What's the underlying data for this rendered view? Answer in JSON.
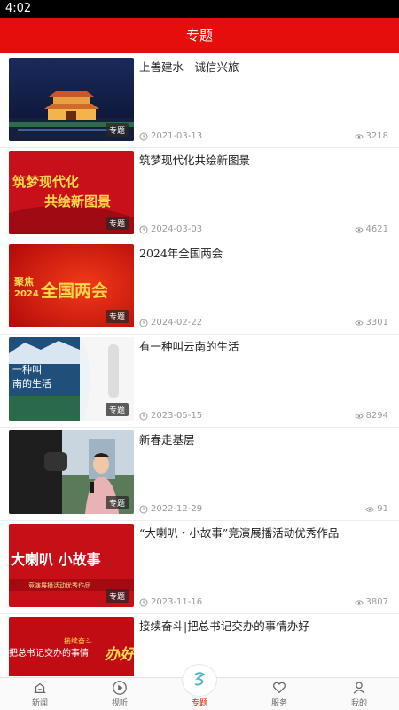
{
  "status": {
    "time": "4:02"
  },
  "header": {
    "title": "专题"
  },
  "items": [
    {
      "title": "上善建水　诚信兴旅",
      "tag": "专题",
      "date": "2021-03-13",
      "views": "3218"
    },
    {
      "title": "筑梦现代化共绘新图景",
      "tag": "专题",
      "date": "2024-03-03",
      "views": "4621",
      "thumb_text": [
        "筑梦现代化",
        "共绘新图景"
      ]
    },
    {
      "title": "2024年全国两会",
      "tag": "专题",
      "date": "2024-02-22",
      "views": "3301",
      "thumb_text": [
        "聚焦",
        "2024",
        "全国两会"
      ]
    },
    {
      "title": "有一种叫云南的生活",
      "tag": "专题",
      "date": "2023-05-15",
      "views": "8294",
      "thumb_text": [
        "一种叫",
        "南的生活"
      ]
    },
    {
      "title": "新春走基层",
      "tag": "专题",
      "date": "2022-12-29",
      "views": "91"
    },
    {
      "title": "“大喇叭・小故事”竞演展播活动优秀作品",
      "tag": "专题",
      "date": "2023-11-16",
      "views": "3807",
      "thumb_text": [
        "大喇叭 小故事",
        "竞演展播活动优秀作品"
      ]
    },
    {
      "title": "接续奋斗|把总书记交办的事情办好",
      "tag": "",
      "date": "",
      "views": "",
      "thumb_text": [
        "接续奋斗",
        "把总书记交办的事情",
        "办好"
      ]
    }
  ],
  "tabs": [
    {
      "label": "新闻",
      "icon": "news-icon"
    },
    {
      "label": "视听",
      "icon": "play-icon"
    },
    {
      "label": "专题",
      "icon": "topic-icon",
      "active": true
    },
    {
      "label": "服务",
      "icon": "heart-icon"
    },
    {
      "label": "我的",
      "icon": "person-icon"
    }
  ],
  "colors": {
    "brand": "#e60d0d"
  }
}
